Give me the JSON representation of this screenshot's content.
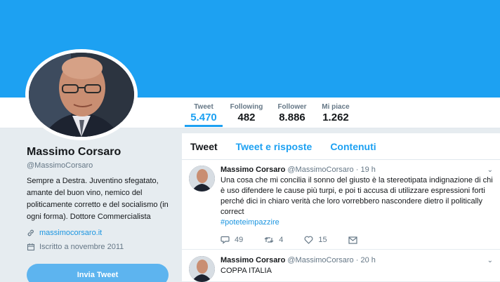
{
  "profile": {
    "name": "Massimo Corsaro",
    "handle": "@MassimoCorsaro",
    "bio": "Sempre a Destra. Juventino sfegatato, amante del buon vino, nemico del politicamente corretto e del socialismo (in ogni forma). Dottore Commercialista",
    "website": "massimocorsaro.it",
    "joined": "Iscritto a novembre 2011",
    "tweet_button": "Invia Tweet"
  },
  "stats": [
    {
      "label": "Tweet",
      "value": "5.470"
    },
    {
      "label": "Following",
      "value": "482"
    },
    {
      "label": "Follower",
      "value": "8.886"
    },
    {
      "label": "Mi piace",
      "value": "1.262"
    }
  ],
  "tabs": [
    "Tweet",
    "Tweet e risposte",
    "Contenuti"
  ],
  "tweets": [
    {
      "name": "Massimo Corsaro",
      "handle": "@MassimoCorsaro",
      "time": "· 19 h",
      "text": "Una cosa che mi concilia il sonno del giusto è la stereotipata indignazione di chi è uso difendere le  cause più turpi,  e poi ti accusa di utilizzare espressioni forti perché dici in chiaro verità che loro vorrebbero nascondere dietro il politically correct",
      "hashtag": "#poteteimpazzire",
      "replies": "49",
      "retweets": "4",
      "likes": "15"
    },
    {
      "name": "Massimo Corsaro",
      "handle": "@MassimoCorsaro",
      "time": "· 20 h",
      "text": "COPPA ITALIA"
    }
  ],
  "colors": {
    "accent": "#1da1f2",
    "banner": "#1da1f2",
    "background": "#e6ecf0"
  }
}
